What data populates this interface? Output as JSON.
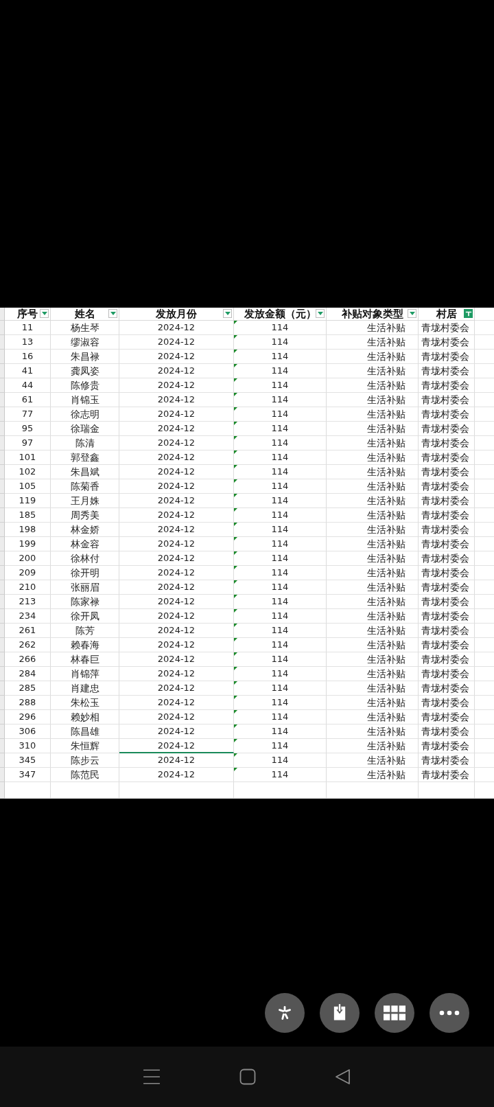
{
  "columns": [
    {
      "label": "序号",
      "filtered": false
    },
    {
      "label": "姓名",
      "filtered": false
    },
    {
      "label": "发放月份",
      "filtered": false
    },
    {
      "label": "发放金额（元）",
      "filtered": false,
      "text_number_marker": true
    },
    {
      "label": "补贴对象类型",
      "filtered": false
    },
    {
      "label": "村居",
      "filtered": true
    }
  ],
  "rows": [
    {
      "cells": [
        "11",
        "杨生琴",
        "2024-12",
        "114",
        "生活补贴",
        "青垅村委会"
      ],
      "selected": false
    },
    {
      "cells": [
        "13",
        "缪淑容",
        "2024-12",
        "114",
        "生活补贴",
        "青垅村委会"
      ],
      "selected": false
    },
    {
      "cells": [
        "16",
        "朱昌禄",
        "2024-12",
        "114",
        "生活补贴",
        "青垅村委会"
      ],
      "selected": false
    },
    {
      "cells": [
        "41",
        "龚凤姿",
        "2024-12",
        "114",
        "生活补贴",
        "青垅村委会"
      ],
      "selected": false
    },
    {
      "cells": [
        "44",
        "陈修贵",
        "2024-12",
        "114",
        "生活补贴",
        "青垅村委会"
      ],
      "selected": false
    },
    {
      "cells": [
        "61",
        "肖锦玉",
        "2024-12",
        "114",
        "生活补贴",
        "青垅村委会"
      ],
      "selected": false
    },
    {
      "cells": [
        "77",
        "徐志明",
        "2024-12",
        "114",
        "生活补贴",
        "青垅村委会"
      ],
      "selected": false
    },
    {
      "cells": [
        "95",
        "徐瑞金",
        "2024-12",
        "114",
        "生活补贴",
        "青垅村委会"
      ],
      "selected": false
    },
    {
      "cells": [
        "97",
        "陈清",
        "2024-12",
        "114",
        "生活补贴",
        "青垅村委会"
      ],
      "selected": false
    },
    {
      "cells": [
        "101",
        "郭登鑫",
        "2024-12",
        "114",
        "生活补贴",
        "青垅村委会"
      ],
      "selected": false
    },
    {
      "cells": [
        "102",
        "朱昌斌",
        "2024-12",
        "114",
        "生活补贴",
        "青垅村委会"
      ],
      "selected": false
    },
    {
      "cells": [
        "105",
        "陈菊香",
        "2024-12",
        "114",
        "生活补贴",
        "青垅村委会"
      ],
      "selected": false
    },
    {
      "cells": [
        "119",
        "王月姝",
        "2024-12",
        "114",
        "生活补贴",
        "青垅村委会"
      ],
      "selected": false
    },
    {
      "cells": [
        "185",
        "周秀美",
        "2024-12",
        "114",
        "生活补贴",
        "青垅村委会"
      ],
      "selected": false
    },
    {
      "cells": [
        "198",
        "林金娇",
        "2024-12",
        "114",
        "生活补贴",
        "青垅村委会"
      ],
      "selected": false
    },
    {
      "cells": [
        "199",
        "林金容",
        "2024-12",
        "114",
        "生活补贴",
        "青垅村委会"
      ],
      "selected": false
    },
    {
      "cells": [
        "200",
        "徐林付",
        "2024-12",
        "114",
        "生活补贴",
        "青垅村委会"
      ],
      "selected": false
    },
    {
      "cells": [
        "209",
        "徐开明",
        "2024-12",
        "114",
        "生活补贴",
        "青垅村委会"
      ],
      "selected": false
    },
    {
      "cells": [
        "210",
        "张丽眉",
        "2024-12",
        "114",
        "生活补贴",
        "青垅村委会"
      ],
      "selected": false
    },
    {
      "cells": [
        "213",
        "陈家禄",
        "2024-12",
        "114",
        "生活补贴",
        "青垅村委会"
      ],
      "selected": false
    },
    {
      "cells": [
        "234",
        "徐开凤",
        "2024-12",
        "114",
        "生活补贴",
        "青垅村委会"
      ],
      "selected": false
    },
    {
      "cells": [
        "261",
        "陈芳",
        "2024-12",
        "114",
        "生活补贴",
        "青垅村委会"
      ],
      "selected": false
    },
    {
      "cells": [
        "262",
        "赖春海",
        "2024-12",
        "114",
        "生活补贴",
        "青垅村委会"
      ],
      "selected": false
    },
    {
      "cells": [
        "266",
        "林春巨",
        "2024-12",
        "114",
        "生活补贴",
        "青垅村委会"
      ],
      "selected": false
    },
    {
      "cells": [
        "284",
        "肖锦萍",
        "2024-12",
        "114",
        "生活补贴",
        "青垅村委会"
      ],
      "selected": false
    },
    {
      "cells": [
        "285",
        "肖建忠",
        "2024-12",
        "114",
        "生活补贴",
        "青垅村委会"
      ],
      "selected": false
    },
    {
      "cells": [
        "288",
        "朱松玉",
        "2024-12",
        "114",
        "生活补贴",
        "青垅村委会"
      ],
      "selected": false
    },
    {
      "cells": [
        "296",
        "赖妙相",
        "2024-12",
        "114",
        "生活补贴",
        "青垅村委会"
      ],
      "selected": false
    },
    {
      "cells": [
        "306",
        "陈昌雄",
        "2024-12",
        "114",
        "生活补贴",
        "青垅村委会"
      ],
      "selected": false
    },
    {
      "cells": [
        "310",
        "朱恒辉",
        "2024-12",
        "114",
        "生活补贴",
        "青垅村委会"
      ],
      "selected": true
    },
    {
      "cells": [
        "345",
        "陈步云",
        "2024-12",
        "114",
        "生活补贴",
        "青垅村委会"
      ],
      "selected": false
    },
    {
      "cells": [
        "347",
        "陈范民",
        "2024-12",
        "114",
        "生活补贴",
        "青垅村委会"
      ],
      "selected": false
    }
  ]
}
